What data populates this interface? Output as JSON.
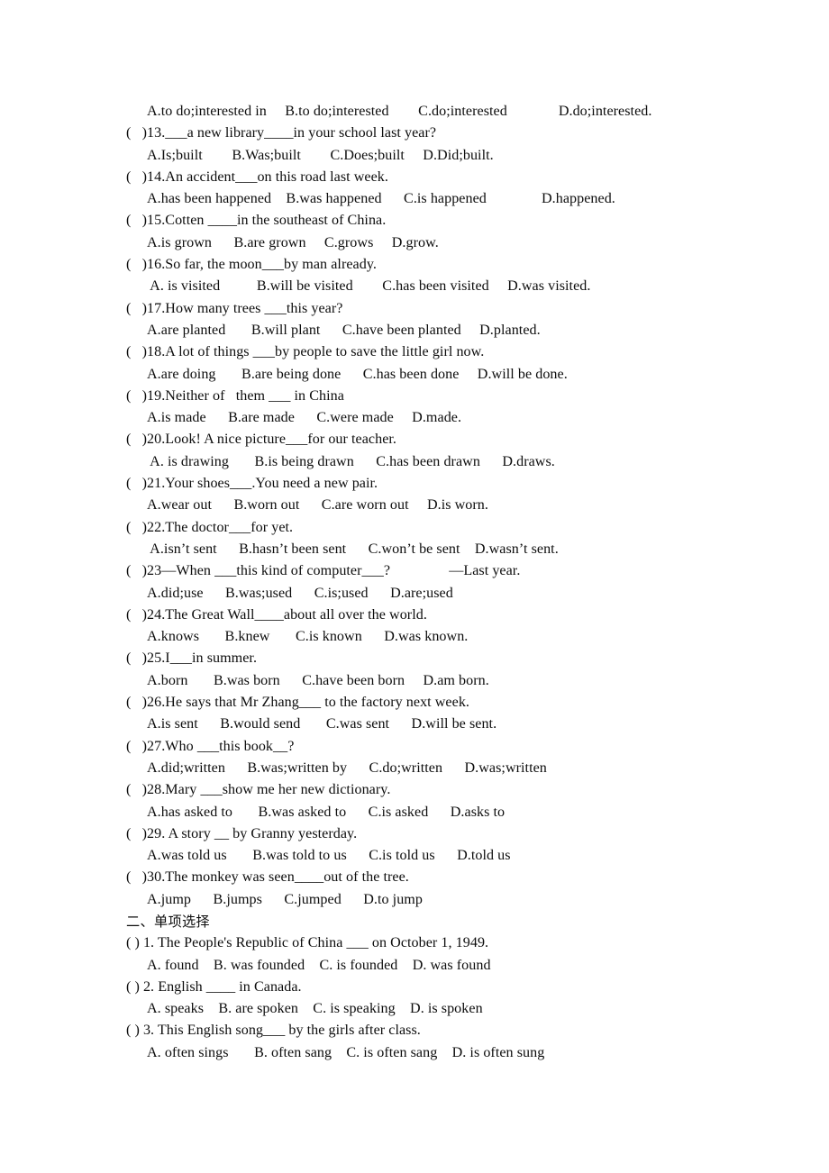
{
  "document": {
    "type": "english-grammar-worksheet",
    "page_background": "#ffffff",
    "text_color": "#0d0d0d",
    "section_one": {
      "continued_options_line": "A.to do;interested in     B.to do;interested        C.do;interested              D.do;interested.",
      "items": [
        {
          "marker": "(   )",
          "number": "13.",
          "question": "(   )13.___a new library____in your school last year?",
          "options": "A.Is;built        B.Was;built        C.Does;built     D.Did;built."
        },
        {
          "marker": "(   )",
          "number": "14.",
          "question": "(   )14.An accident___on this road last week.",
          "options": "A.has been happened    B.was happened      C.is happened               D.happened."
        },
        {
          "marker": "(   )",
          "number": "15.",
          "question": "(   )15.Cotten ____in the southeast of China.",
          "options": "A.is grown      B.are grown     C.grows     D.grow."
        },
        {
          "marker": "(   )",
          "number": "16.",
          "question": "(   )16.So far, the moon___by man already.",
          "options": " A. is visited          B.will be visited        C.has been visited     D.was visited."
        },
        {
          "marker": "(   )",
          "number": "17.",
          "question": "(   )17.How many trees ___this year?",
          "options": "A.are planted       B.will plant      C.have been planted     D.planted."
        },
        {
          "marker": "(   )",
          "number": "18.",
          "question": "(   )18.A lot of things ___by people to save the little girl now.",
          "options": "A.are doing       B.are being done      C.has been done     D.will be done."
        },
        {
          "marker": "(   )",
          "number": "19.",
          "question": "(   )19.Neither of   them ___ in China",
          "options": "A.is made      B.are made      C.were made     D.made."
        },
        {
          "marker": "(   )",
          "number": "20.",
          "question": "(   )20.Look! A nice picture___for our teacher.",
          "options": " A. is drawing       B.is being drawn      C.has been drawn      D.draws."
        },
        {
          "marker": "(   )",
          "number": "21.",
          "question": "(   )21.Your shoes___.You need a new pair.",
          "options": "A.wear out      B.worn out      C.are worn out     D.is worn."
        },
        {
          "marker": "(   )",
          "number": "22.",
          "question": "(   )22.The doctor___for yet.",
          "options": " A.isn’t sent      B.hasn’t been sent      C.won’t be sent    D.wasn’t sent."
        },
        {
          "marker": "(   )",
          "number": "23",
          "question": "(   )23—When ___this kind of computer___?                —Last year.",
          "options": "A.did;use      B.was;used      C.is;used      D.are;used"
        },
        {
          "marker": "(   )",
          "number": "24.",
          "question": "(   )24.The Great Wall____about all over the world.",
          "options": "A.knows       B.knew       C.is known      D.was known."
        },
        {
          "marker": "(   )",
          "number": "25.",
          "question": "(   )25.I___in summer.",
          "options": "A.born       B.was born      C.have been born     D.am born."
        },
        {
          "marker": "(   )",
          "number": "26.",
          "question": "(   )26.He says that Mr Zhang___ to the factory next week.",
          "options": "A.is sent      B.would send       C.was sent      D.will be sent."
        },
        {
          "marker": "(   )",
          "number": "27.",
          "question": "(   )27.Who ___this book__?",
          "options": "A.did;written      B.was;written by      C.do;written      D.was;written"
        },
        {
          "marker": "(   )",
          "number": "28.",
          "question": "(   )28.Mary ___show me her new dictionary.",
          "options": "A.has asked to       B.was asked to      C.is asked      D.asks to"
        },
        {
          "marker": "(   )",
          "number": "29.",
          "question": "(   )29. A story __ by Granny yesterday.",
          "options": "A.was told us       B.was told to us      C.is told us      D.told us"
        },
        {
          "marker": "(   )",
          "number": "30.",
          "question": "(   )30.The monkey was seen____out of the tree.",
          "options": "A.jump      B.jumps      C.jumped      D.to jump"
        }
      ]
    },
    "section_two": {
      "heading": "二、单项选择",
      "items": [
        {
          "marker": "( )",
          "number": "1.",
          "question": "( ) 1. The People's Republic of China ___ on October 1, 1949.",
          "options": "A. found    B. was founded    C. is founded    D. was found"
        },
        {
          "marker": "( )",
          "number": "2.",
          "question": "( ) 2. English ____ in Canada.",
          "options": "A. speaks    B. are spoken    C. is speaking    D. is spoken"
        },
        {
          "marker": "( )",
          "number": "3.",
          "question": "( ) 3. This English song___ by the girls after class.",
          "options": "A. often sings       B. often sang    C. is often sang    D. is often sung"
        }
      ]
    }
  }
}
